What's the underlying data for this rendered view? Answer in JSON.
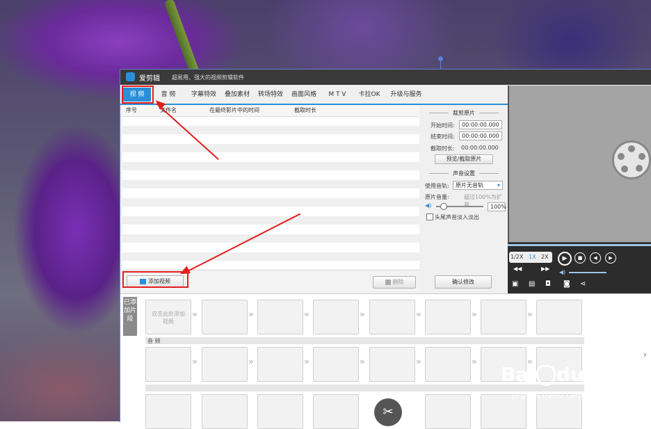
{
  "app": {
    "name": "爱剪辑",
    "slogan": "超易用、强大的视频剪辑软件"
  },
  "tabs": [
    "视 频",
    "音 频",
    "字幕特效",
    "叠加素材",
    "转场特效",
    "画面风格",
    "M T V",
    "卡拉OK",
    "升级与服务"
  ],
  "video_list": {
    "columns": [
      "序号",
      "文件名",
      "在最终影片中的时间",
      "截取时长"
    ],
    "add_button": "添加视频",
    "delete_button": "删除"
  },
  "clip_panel": {
    "title": "裁剪原片",
    "start_label": "开始时间:",
    "start_value": "00:00:00.000",
    "end_label": "结束时间:",
    "end_value": "00:00:00.000",
    "duration_label": "截取时长:",
    "duration_value": "00:00:00.000",
    "preview_button": "预览/截取原片"
  },
  "sound_panel": {
    "title": "声音设置",
    "track_label": "使用音轨:",
    "track_value": "原片无音轨",
    "volume_label": "原片音量:",
    "volume_hint": "超过100%为扩音",
    "volume_value": "100%",
    "fade_label": "头尾声音淡入淡出",
    "confirm_button": "确认修改"
  },
  "player": {
    "speeds": [
      "1/2X",
      "1X",
      "2X"
    ]
  },
  "clips": {
    "side_label": "已添加片段",
    "empty_hint": "双击此处添加视频",
    "audio_label": "音 频"
  },
  "watermark": {
    "brand": "Bai",
    "brand2": "du",
    "brand_cn": "经验",
    "url": "jingyan.baidu.com"
  }
}
